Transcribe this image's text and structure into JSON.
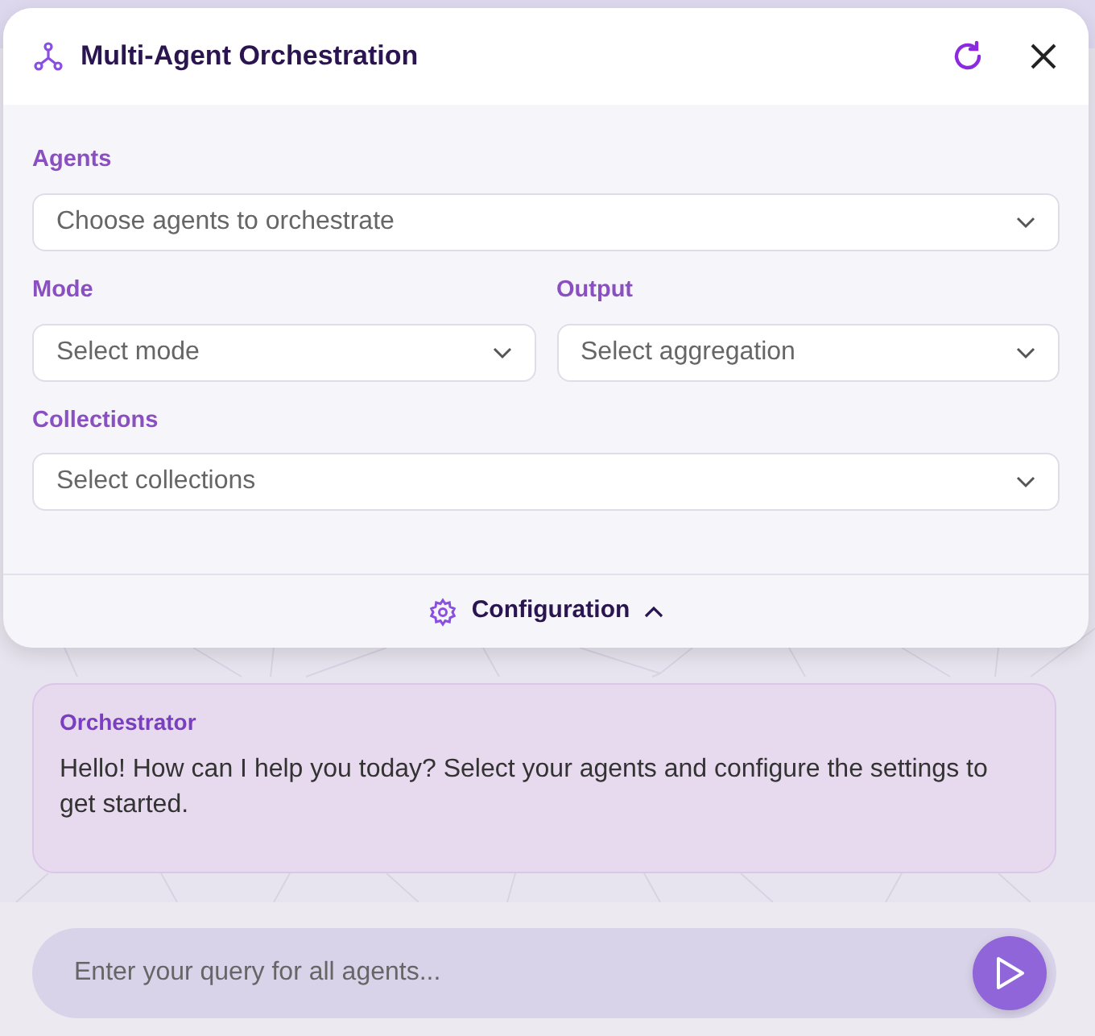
{
  "panel": {
    "title": "Multi-Agent Orchestration",
    "fields": [
      {
        "label": "Agents",
        "placeholder": "Choose agents to orchestrate",
        "kind": "wide"
      },
      {
        "label": "Mode",
        "placeholder": "Select mode",
        "kind": "narrow"
      },
      {
        "label": "Output",
        "placeholder": "Select aggregation",
        "kind": "narrow"
      },
      {
        "label": "Collections",
        "placeholder": "Select collections",
        "kind": "wide"
      }
    ],
    "configuration": {
      "label": "Configuration",
      "expanded": true
    }
  },
  "messages": [
    {
      "sender": "Orchestrator",
      "text": "Hello! How can I help you today? Select your agents and configure the settings to get started."
    }
  ],
  "composer": {
    "placeholder": "Enter your query for all agents..."
  }
}
